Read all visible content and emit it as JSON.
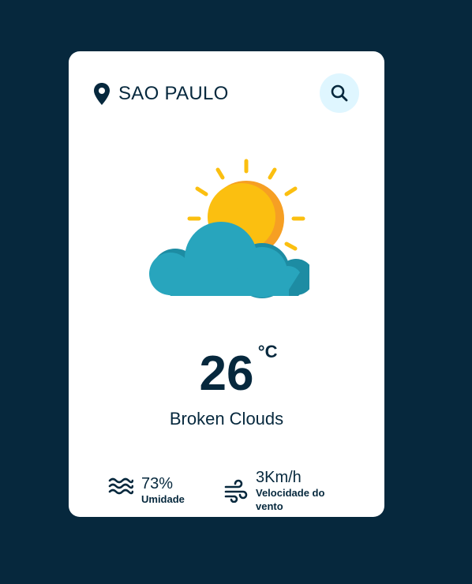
{
  "location": {
    "icon": "map-pin-icon",
    "city": "SAO PAULO"
  },
  "search": {
    "icon": "search-icon"
  },
  "weather": {
    "illustration": "sun-behind-cloud-icon",
    "temperature": "26",
    "unit": "°C",
    "description": "Broken Clouds"
  },
  "details": {
    "humidity": {
      "icon": "waves-icon",
      "value": "73%",
      "label": "Umidade"
    },
    "wind": {
      "icon": "wind-icon",
      "value": "3Km/h",
      "label": "Velocidade do vento"
    }
  },
  "colors": {
    "background": "#06283d",
    "card": "#ffffff",
    "text": "#06283d",
    "search_button_bg": "#dff6ff",
    "sun": "#fbbf10",
    "sun_shade": "#f69f23",
    "cloud": "#28a5bd",
    "cloud_shade": "#1d8ca3"
  }
}
